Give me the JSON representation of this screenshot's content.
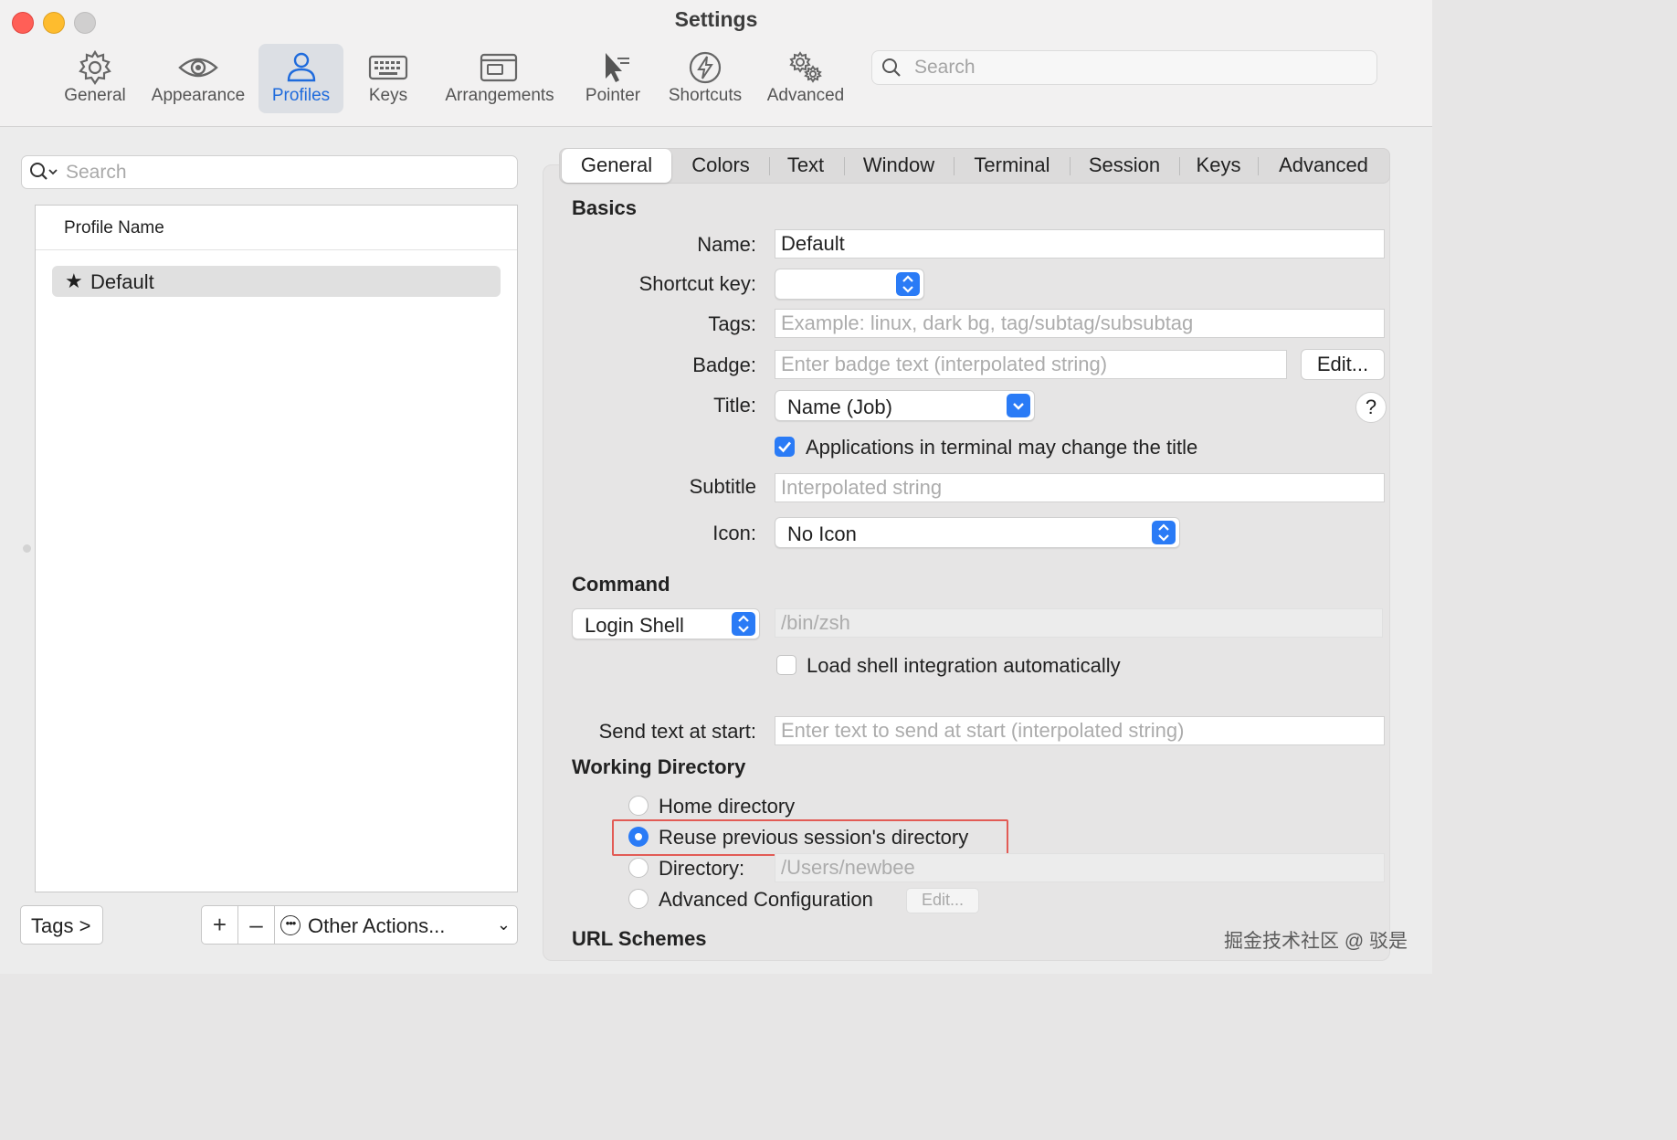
{
  "window": {
    "title": "Settings"
  },
  "toolbar": {
    "items": [
      {
        "label": "General",
        "icon": "gear-icon"
      },
      {
        "label": "Appearance",
        "icon": "eye-icon"
      },
      {
        "label": "Profiles",
        "icon": "person-icon",
        "active": true
      },
      {
        "label": "Keys",
        "icon": "keyboard-icon"
      },
      {
        "label": "Arrangements",
        "icon": "windows-icon"
      },
      {
        "label": "Pointer",
        "icon": "pointer-icon"
      },
      {
        "label": "Shortcuts",
        "icon": "bolt-icon"
      },
      {
        "label": "Advanced",
        "icon": "gears-icon"
      }
    ],
    "search_placeholder": "Search"
  },
  "left": {
    "search_placeholder": "Search",
    "table_header": "Profile Name",
    "profiles": [
      {
        "name": "Default",
        "default": true
      }
    ],
    "tags_button": "Tags >",
    "add_symbol": "+",
    "remove_symbol": "–",
    "other_actions": "Other Actions..."
  },
  "tabs": [
    "General",
    "Colors",
    "Text",
    "Window",
    "Terminal",
    "Session",
    "Keys",
    "Advanced"
  ],
  "active_tab": "General",
  "basics": {
    "heading": "Basics",
    "name_label": "Name:",
    "name_value": "Default",
    "shortcut_label": "Shortcut key:",
    "tags_label": "Tags:",
    "tags_placeholder": "Example: linux, dark bg, tag/subtag/subsubtag",
    "badge_label": "Badge:",
    "badge_placeholder": "Enter badge text (interpolated string)",
    "badge_edit": "Edit...",
    "title_label": "Title:",
    "title_value": "Name (Job)",
    "help": "?",
    "change_title_checkbox": "Applications in terminal may change the title",
    "change_title_checked": true,
    "subtitle_label": "Subtitle",
    "subtitle_placeholder": "Interpolated string",
    "icon_label": "Icon:",
    "icon_value": "No Icon"
  },
  "command": {
    "heading": "Command",
    "shell_value": "Login Shell",
    "shell_path": "/bin/zsh",
    "integration_checkbox": "Load shell integration automatically",
    "integration_checked": false,
    "send_text_label": "Send text at start:",
    "send_text_placeholder": "Enter text to send at start (interpolated string)"
  },
  "working_directory": {
    "heading": "Working Directory",
    "options": [
      "Home directory",
      "Reuse previous session's directory",
      "Directory:",
      "Advanced Configuration"
    ],
    "selected": "Reuse previous session's directory",
    "directory_value": "/Users/newbee",
    "advanced_edit": "Edit..."
  },
  "url_schemes": {
    "heading": "URL Schemes"
  },
  "watermark": "掘金技术社区 @ 驳是",
  "colors": {
    "accent": "#2a7bf6",
    "highlight_box": "#e25b55",
    "active_toolbar_text": "#1f6bdc"
  }
}
